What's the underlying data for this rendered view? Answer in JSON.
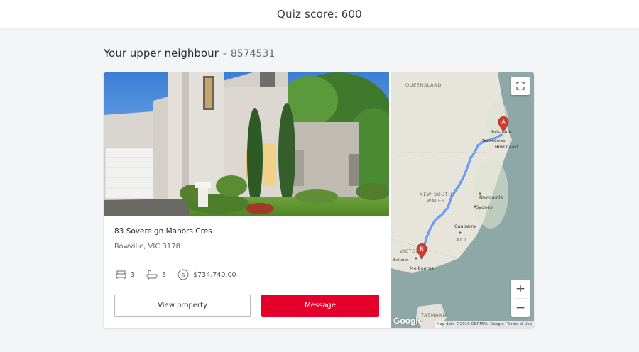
{
  "header": {
    "quiz_score": "Quiz score: 600"
  },
  "section": {
    "title": "Your upper neighbour",
    "separator": "-",
    "property_id": "8574531"
  },
  "property": {
    "address_line1": "83 Sovereign Manors Cres",
    "address_line2": "Rowville, VIC 3178",
    "bedrooms": "3",
    "bathrooms": "3",
    "price": "$734,740.00",
    "view_button": "View property",
    "message_button": "Message"
  },
  "map": {
    "region_labels": {
      "queensland": "QUEENSLAND",
      "nsw_line1": "NEW SOUTH",
      "nsw_line2": "WALES",
      "victoria": "VICTORIA",
      "tasmania": "TASMANIA",
      "act": "ACT"
    },
    "cities": {
      "brisbane": "Brisbane",
      "toowoomba": "Toowoomba",
      "gold_coast": "Gold Coast",
      "newcastle": "Newcastle",
      "sydney": "Sydney",
      "canberra": "Canberra",
      "melbourne": "Melbourne",
      "ballarat": "Ballarat"
    },
    "marker_a": "A",
    "marker_b": "B",
    "zoom_in": "+",
    "zoom_out": "−",
    "google_logo": "Google",
    "attribution": "Map data ©2019 GBRMPA, Google",
    "terms": "Terms of Use",
    "colors": {
      "land": "#e7e4dc",
      "water": "#8ea8a7",
      "route": "#6e9cf2",
      "marker": "#d93b30"
    }
  },
  "colors": {
    "message_button": "#e4002b"
  }
}
